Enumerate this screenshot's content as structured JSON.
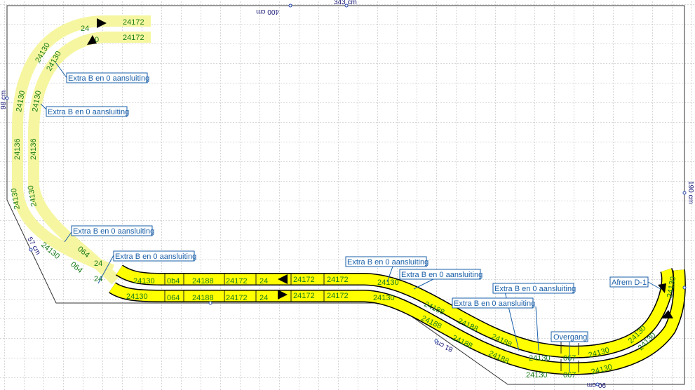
{
  "dimensions": {
    "top_400": "400 cm",
    "top_343": "343 cm",
    "left_98": "98 cm",
    "right_190": "190 cm",
    "diag_57": "57 cm",
    "diag_81": "81 cm",
    "bottom_90": "90 cm"
  },
  "callouts": {
    "c1": "Extra B en 0 aansluiting",
    "c2": "Extra B en 0 aansluiting",
    "c3": "Extra B en 0 aansluiting",
    "c4": "Extra B en 0 aansluiting",
    "c5": "Extra B en 0 aansluiting",
    "c6": "Extra B en 0 aansluiting",
    "c7": "Extra B en 0 aansluiting",
    "c8": "Extra B en 0 aansluiting",
    "overgang": "Overgang",
    "afrem": "Afrem D-1"
  },
  "track_codes": {
    "t24172": "24172",
    "t24130": "24130",
    "t24136": "24136",
    "t24188": "24188",
    "t0": "0",
    "t064": "064",
    "t067": "067",
    "t0b4": "0b4",
    "t24": "24"
  },
  "colors": {
    "track_fill": "#ffff00",
    "track_faded": "#fbfbb0",
    "grid": "#8c8c8c",
    "outline": "#333333",
    "label": "#1a5fa8",
    "track_text": "#1b7d1b"
  }
}
